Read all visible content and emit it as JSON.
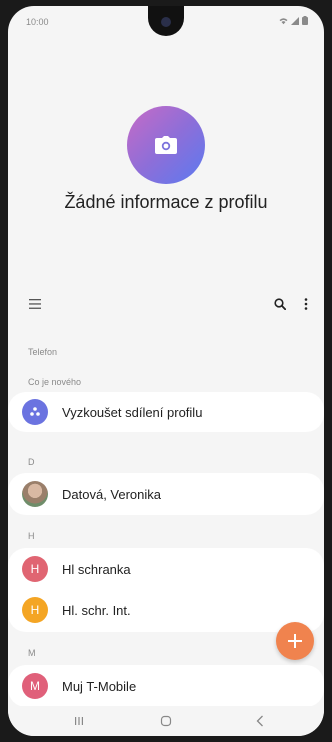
{
  "status_bar": {
    "time": "10:00",
    "icons": [
      "wifi-icon",
      "signal-icon",
      "battery-icon"
    ]
  },
  "profile": {
    "title": "Žádné informace z profilu",
    "icon": "camera-icon",
    "gradient": [
      "#c76bc6",
      "#5b7af0"
    ]
  },
  "toolbar": {
    "menu_icon": "hamburger-menu-icon",
    "search_icon": "search-icon",
    "more_icon": "more-vert-icon"
  },
  "sections": {
    "telefon": "Telefon",
    "new": "Co je nového",
    "d": "D",
    "h": "H",
    "m": "M"
  },
  "contacts": [
    {
      "name": "Vyzkoušet sdílení profilu",
      "initial": "",
      "color": "#6b73e0"
    },
    {
      "name": "Datová, Veronika",
      "initial": "",
      "color": "#b9a08e"
    },
    {
      "name": "Hl schranka",
      "initial": "H",
      "color": "#e06572"
    },
    {
      "name": "Hl. schr. Int.",
      "initial": "H",
      "color": "#f4a524"
    },
    {
      "name": "Muj T-Mobile",
      "initial": "M",
      "color": "#e0607a"
    }
  ],
  "fab": {
    "label": "+",
    "color": "#f0834e"
  },
  "navbar": {
    "recent_icon": "recent-apps-icon",
    "home_icon": "home-icon",
    "back_icon": "back-icon"
  }
}
